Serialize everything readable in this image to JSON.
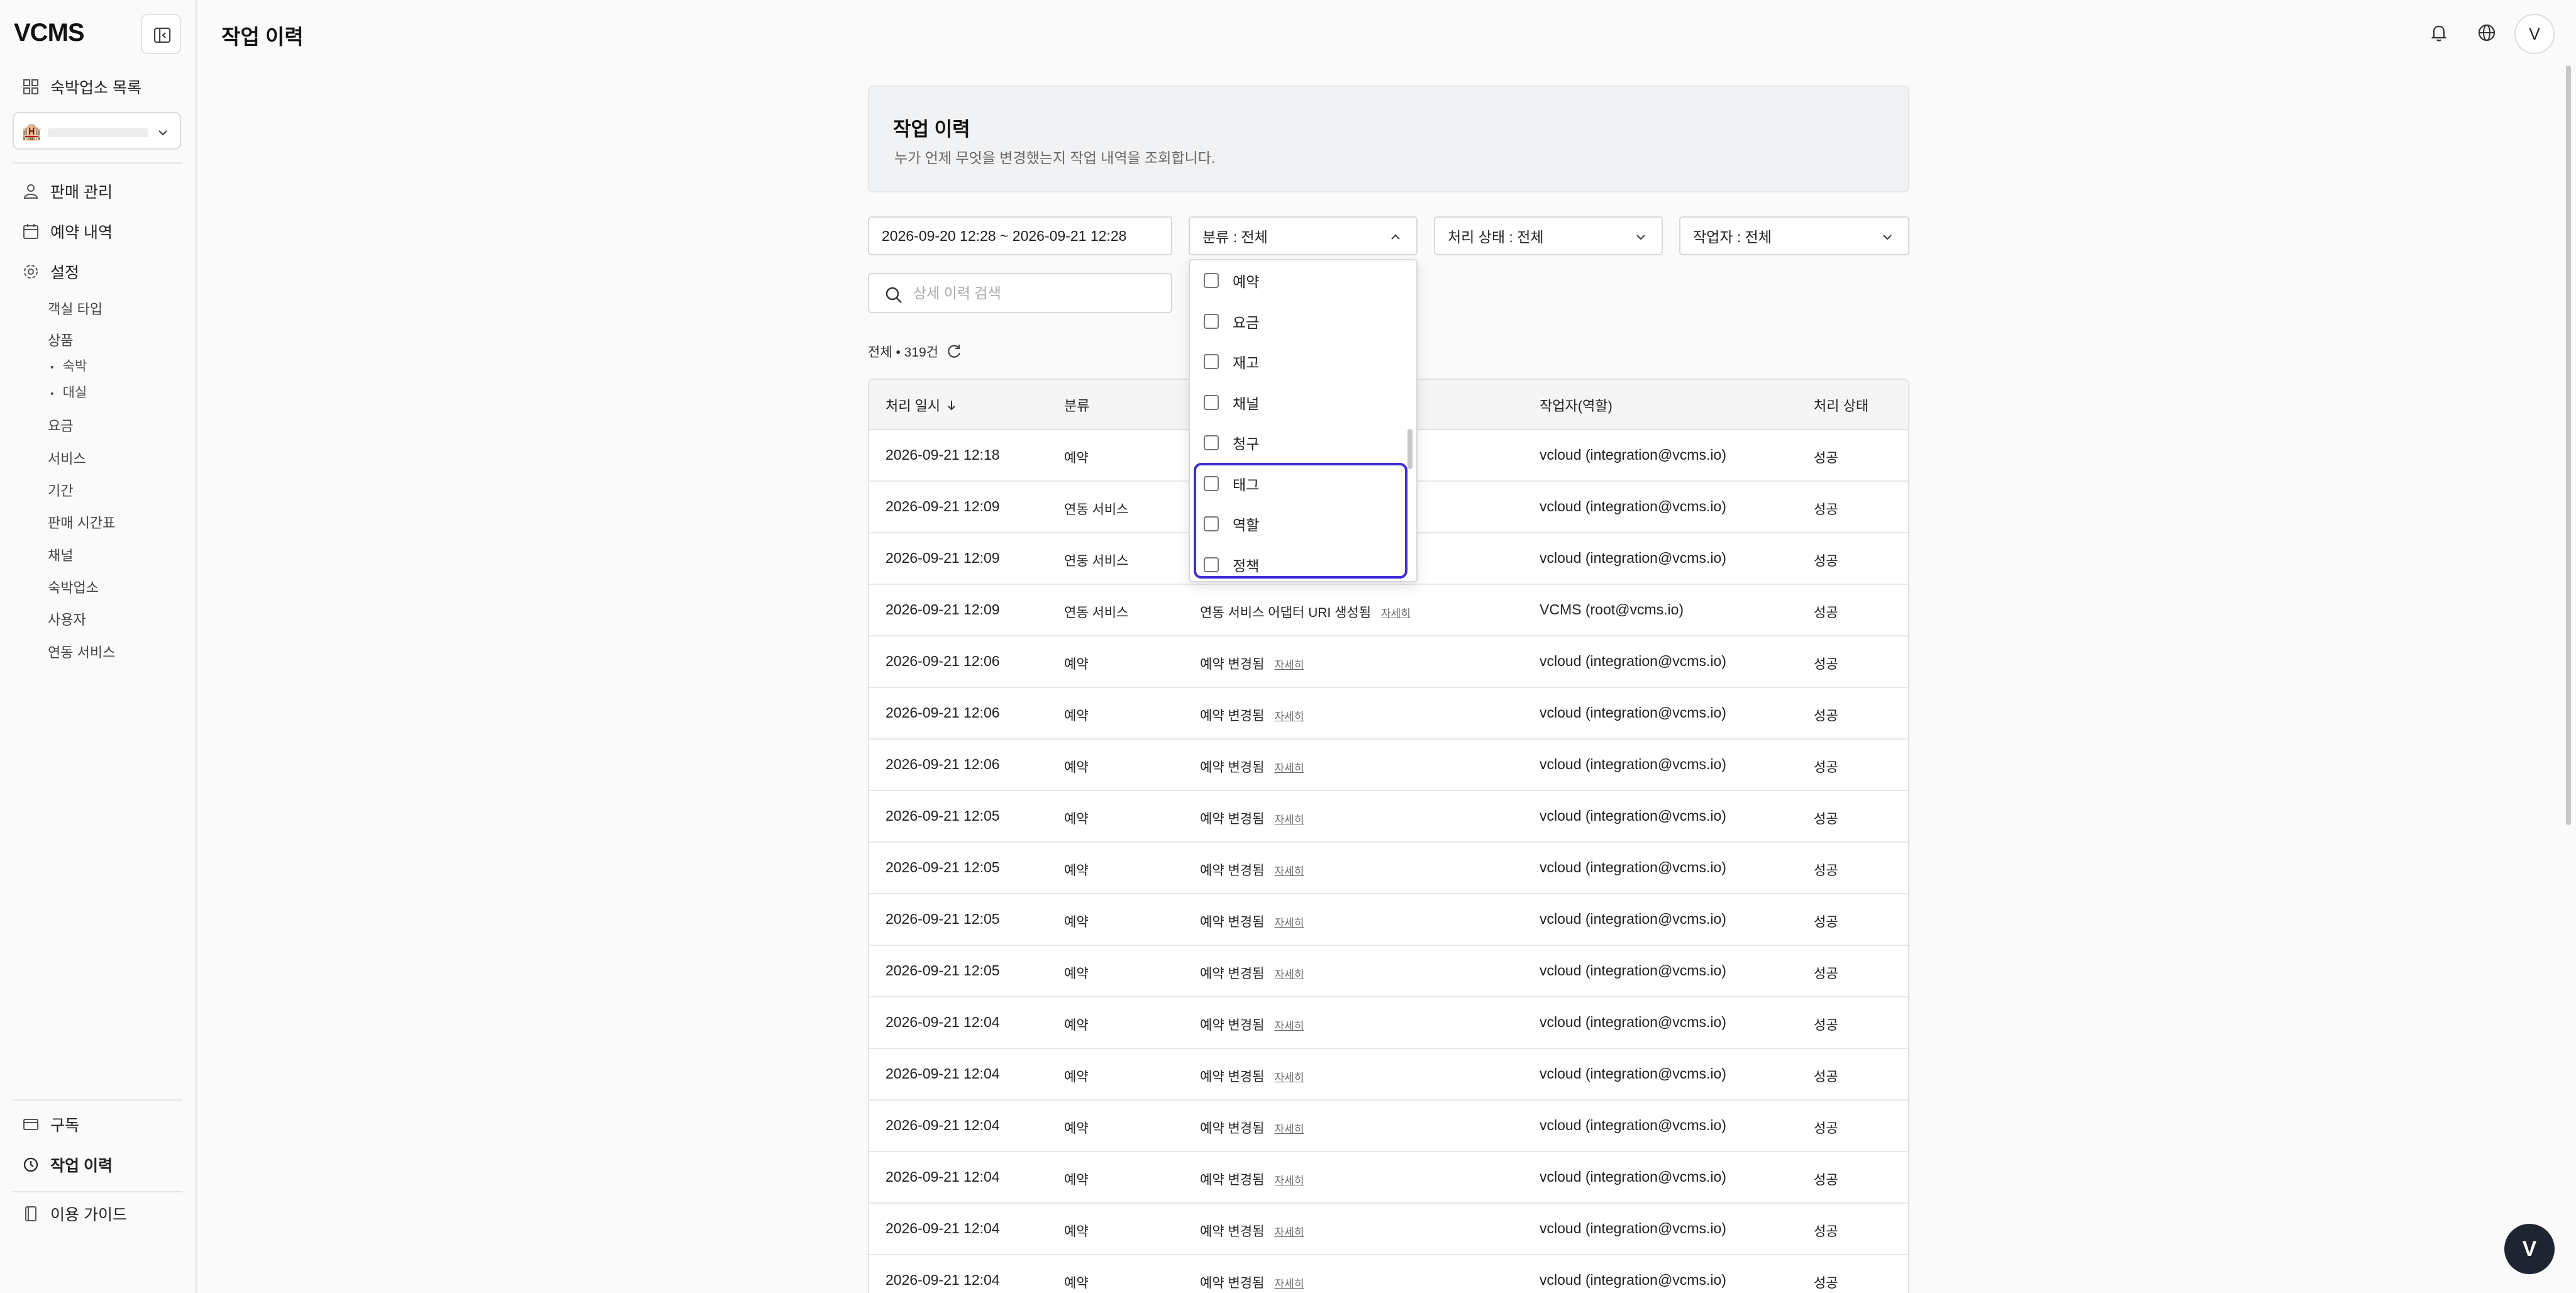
{
  "app": {
    "logo": "VCMS",
    "page_title": "작업 이력",
    "avatar_letter": "V",
    "fab_letter": "V"
  },
  "sidebar": {
    "property_list": "숙박업소 목록",
    "property_emoji": "🏨",
    "items": {
      "sales": "판매 관리",
      "reservations": "예약 내역",
      "settings": "설정",
      "room_type": "객실 타입",
      "products": "상품",
      "product_stay": "숙박",
      "product_dayuse": "대실",
      "rates": "요금",
      "services": "서비스",
      "period": "기간",
      "sales_schedule": "판매 시간표",
      "channels": "채널",
      "properties": "숙박업소",
      "users": "사용자",
      "integrations": "연동 서비스",
      "subscription": "구독",
      "activity_log": "작업 이력",
      "guide": "이용 가이드"
    }
  },
  "intro": {
    "title": "작업 이력",
    "desc": "누가 언제 무엇을 변경했는지 작업 내역을 조회합니다."
  },
  "filters": {
    "date_range": "2026-09-20 12:28 ~ 2026-09-21 12:28",
    "category": "분류 : 전체",
    "status": "처리 상태 : 전체",
    "actor": "작업자 : 전체",
    "search_placeholder": "상세 이력 검색"
  },
  "count_text": "전체 • 319건",
  "dropdown": {
    "options": [
      "예약",
      "요금",
      "재고",
      "채널",
      "청구",
      "태그",
      "역할",
      "정책"
    ]
  },
  "table": {
    "headers": {
      "time": "처리 일시",
      "category": "분류",
      "actor": "작업자(역할)",
      "status": "처리 상태"
    },
    "detail_label": "자세히",
    "rows": [
      {
        "time": "2026-09-21 12:18",
        "category": "예약",
        "desc": "",
        "actor": "vcloud (integration@vcms.io)",
        "status": "성공"
      },
      {
        "time": "2026-09-21 12:09",
        "category": "연동 서비스",
        "desc": "",
        "actor": "vcloud (integration@vcms.io)",
        "status": "성공"
      },
      {
        "time": "2026-09-21 12:09",
        "category": "연동 서비스",
        "desc": "",
        "actor": "vcloud (integration@vcms.io)",
        "status": "성공"
      },
      {
        "time": "2026-09-21 12:09",
        "category": "연동 서비스",
        "desc": "연동 서비스 어댑터 URI 생성됨",
        "actor": "VCMS (root@vcms.io)",
        "status": "성공"
      },
      {
        "time": "2026-09-21 12:06",
        "category": "예약",
        "desc": "예약 변경됨",
        "actor": "vcloud (integration@vcms.io)",
        "status": "성공"
      },
      {
        "time": "2026-09-21 12:06",
        "category": "예약",
        "desc": "예약 변경됨",
        "actor": "vcloud (integration@vcms.io)",
        "status": "성공"
      },
      {
        "time": "2026-09-21 12:06",
        "category": "예약",
        "desc": "예약 변경됨",
        "actor": "vcloud (integration@vcms.io)",
        "status": "성공"
      },
      {
        "time": "2026-09-21 12:05",
        "category": "예약",
        "desc": "예약 변경됨",
        "actor": "vcloud (integration@vcms.io)",
        "status": "성공"
      },
      {
        "time": "2026-09-21 12:05",
        "category": "예약",
        "desc": "예약 변경됨",
        "actor": "vcloud (integration@vcms.io)",
        "status": "성공"
      },
      {
        "time": "2026-09-21 12:05",
        "category": "예약",
        "desc": "예약 변경됨",
        "actor": "vcloud (integration@vcms.io)",
        "status": "성공"
      },
      {
        "time": "2026-09-21 12:05",
        "category": "예약",
        "desc": "예약 변경됨",
        "actor": "vcloud (integration@vcms.io)",
        "status": "성공"
      },
      {
        "time": "2026-09-21 12:04",
        "category": "예약",
        "desc": "예약 변경됨",
        "actor": "vcloud (integration@vcms.io)",
        "status": "성공"
      },
      {
        "time": "2026-09-21 12:04",
        "category": "예약",
        "desc": "예약 변경됨",
        "actor": "vcloud (integration@vcms.io)",
        "status": "성공"
      },
      {
        "time": "2026-09-21 12:04",
        "category": "예약",
        "desc": "예약 변경됨",
        "actor": "vcloud (integration@vcms.io)",
        "status": "성공"
      },
      {
        "time": "2026-09-21 12:04",
        "category": "예약",
        "desc": "예약 변경됨",
        "actor": "vcloud (integration@vcms.io)",
        "status": "성공"
      },
      {
        "time": "2026-09-21 12:04",
        "category": "예약",
        "desc": "예약 변경됨",
        "actor": "vcloud (integration@vcms.io)",
        "status": "성공"
      },
      {
        "time": "2026-09-21 12:04",
        "category": "예약",
        "desc": "예약 변경됨",
        "actor": "vcloud (integration@vcms.io)",
        "status": "성공"
      }
    ]
  },
  "colors": {
    "highlight": "#3d2fd6",
    "fab_bg": "#1e2430"
  }
}
